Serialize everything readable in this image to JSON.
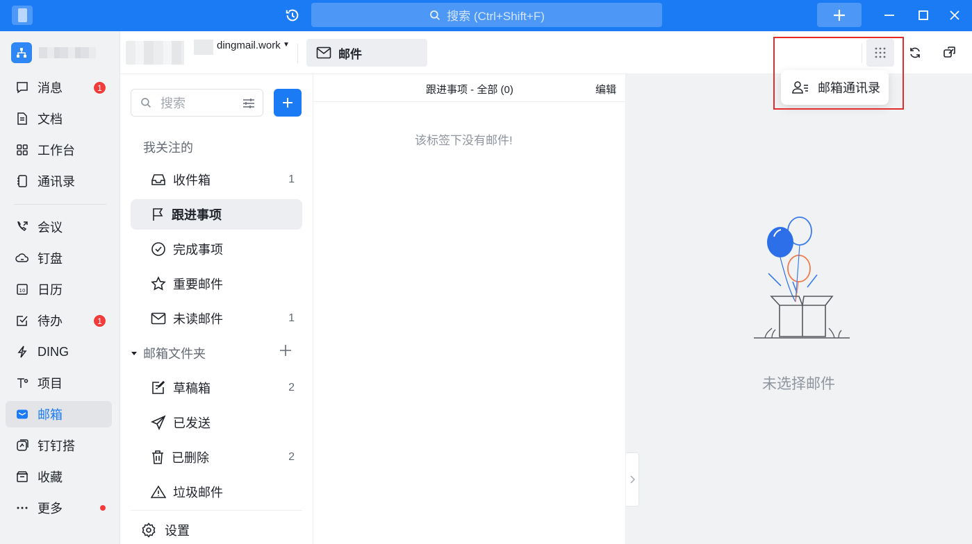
{
  "titlebar": {
    "search_placeholder": "搜索 (Ctrl+Shift+F)",
    "icons": [
      "history-icon",
      "search-icon",
      "plus-icon",
      "minimize-icon",
      "maximize-icon",
      "close-icon"
    ]
  },
  "nav": {
    "items": [
      {
        "label": "消息",
        "icon": "message-icon",
        "badge": "1"
      },
      {
        "label": "文档",
        "icon": "document-icon"
      },
      {
        "label": "工作台",
        "icon": "workbench-icon"
      },
      {
        "label": "通讯录",
        "icon": "contacts-icon"
      },
      {
        "label": "会议",
        "icon": "meeting-icon"
      },
      {
        "label": "钉盘",
        "icon": "cloud-drive-icon"
      },
      {
        "label": "日历",
        "icon": "calendar-icon"
      },
      {
        "label": "待办",
        "icon": "todo-icon",
        "badge": "1"
      },
      {
        "label": "DING",
        "icon": "ding-icon"
      },
      {
        "label": "项目",
        "icon": "project-icon"
      },
      {
        "label": "邮箱",
        "icon": "mail-icon",
        "active": true
      },
      {
        "label": "钉钉搭",
        "icon": "builder-icon"
      },
      {
        "label": "收藏",
        "icon": "favorites-icon"
      },
      {
        "label": "更多",
        "icon": "more-icon",
        "dot": true
      }
    ]
  },
  "header": {
    "account_domain": "dingmail.work",
    "tab_label": "邮件"
  },
  "popup": {
    "label": "邮箱通讯录"
  },
  "folders": {
    "search_placeholder": "搜索",
    "followed_title": "我关注的",
    "followed": [
      {
        "label": "收件箱",
        "count": "1"
      },
      {
        "label": "跟进事项",
        "count": "",
        "active": true
      },
      {
        "label": "完成事项",
        "count": ""
      },
      {
        "label": "重要邮件",
        "count": ""
      },
      {
        "label": "未读邮件",
        "count": "1"
      }
    ],
    "mailbox_title": "邮箱文件夹",
    "mailbox": [
      {
        "label": "草稿箱",
        "count": "2"
      },
      {
        "label": "已发送",
        "count": ""
      },
      {
        "label": "已删除",
        "count": "2"
      },
      {
        "label": "垃圾邮件",
        "count": ""
      }
    ],
    "settings_label": "设置"
  },
  "list": {
    "title": "跟进事项 - 全部 (0)",
    "edit_label": "编辑",
    "empty_text": "该标签下没有邮件!"
  },
  "preview": {
    "empty_text": "未选择邮件"
  },
  "colors": {
    "brand": "#1b7bf5",
    "badge": "#f23c3c",
    "highlight": "#e32b2b"
  }
}
